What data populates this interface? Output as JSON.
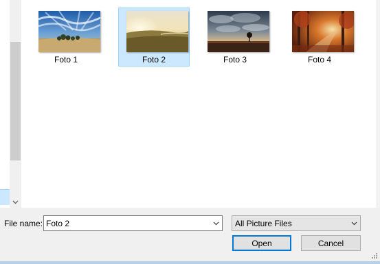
{
  "files": [
    {
      "name": "Foto 1",
      "selected": false,
      "thumb": "desert-sky"
    },
    {
      "name": "Foto 2",
      "selected": true,
      "thumb": "sunset-field"
    },
    {
      "name": "Foto 3",
      "selected": false,
      "thumb": "cloudy-plain"
    },
    {
      "name": "Foto 4",
      "selected": false,
      "thumb": "autumn-forest"
    }
  ],
  "bottom": {
    "file_name_label": "File name:",
    "file_name_value": "Foto 2",
    "filter_value": "All Picture Files",
    "open_label": "Open",
    "cancel_label": "Cancel"
  },
  "colors": {
    "selection_bg": "#cce8ff",
    "selection_border": "#99d1ff",
    "default_button_border": "#0078d7"
  }
}
